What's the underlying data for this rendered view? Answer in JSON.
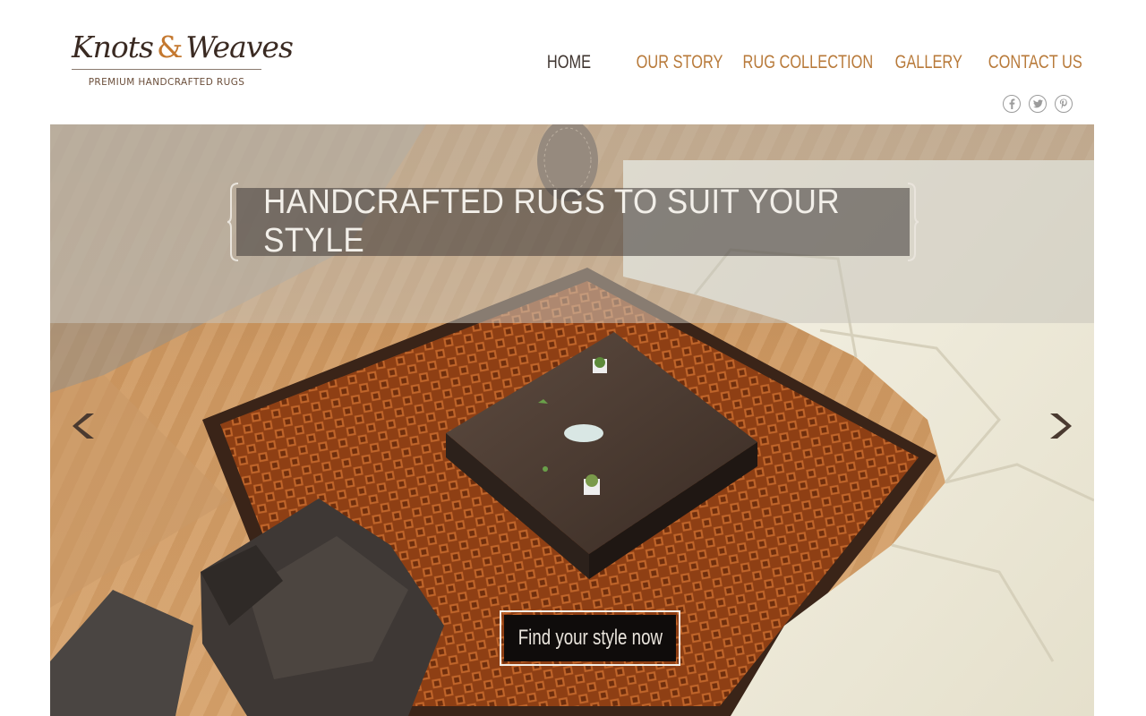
{
  "logo": {
    "script_part1": "Knots",
    "ampersand": "&",
    "script_part2": "Weaves",
    "tagline": "PREMIUM HANDCRAFTED RUGS"
  },
  "nav": {
    "items": [
      {
        "label": "HOME",
        "active": true
      },
      {
        "label": "OUR STORY",
        "active": false
      },
      {
        "label": "RUG COLLECTION",
        "active": false
      },
      {
        "label": "GALLERY",
        "active": false
      },
      {
        "label": "CONTACT US",
        "active": false
      }
    ]
  },
  "social": {
    "icons": [
      "facebook-icon",
      "twitter-icon",
      "pinterest-icon"
    ]
  },
  "hero": {
    "headline": "HANDCRAFTED RUGS TO SUIT YOUR STYLE",
    "cta_label": "Find your style now",
    "prev_icon": "chevron-left-icon",
    "next_icon": "chevron-right-icon"
  },
  "colors": {
    "accent": "#b87a3a",
    "nav_active": "#3f3530",
    "cta_bg": "#0f0c0b",
    "rug": "#a2521f"
  }
}
